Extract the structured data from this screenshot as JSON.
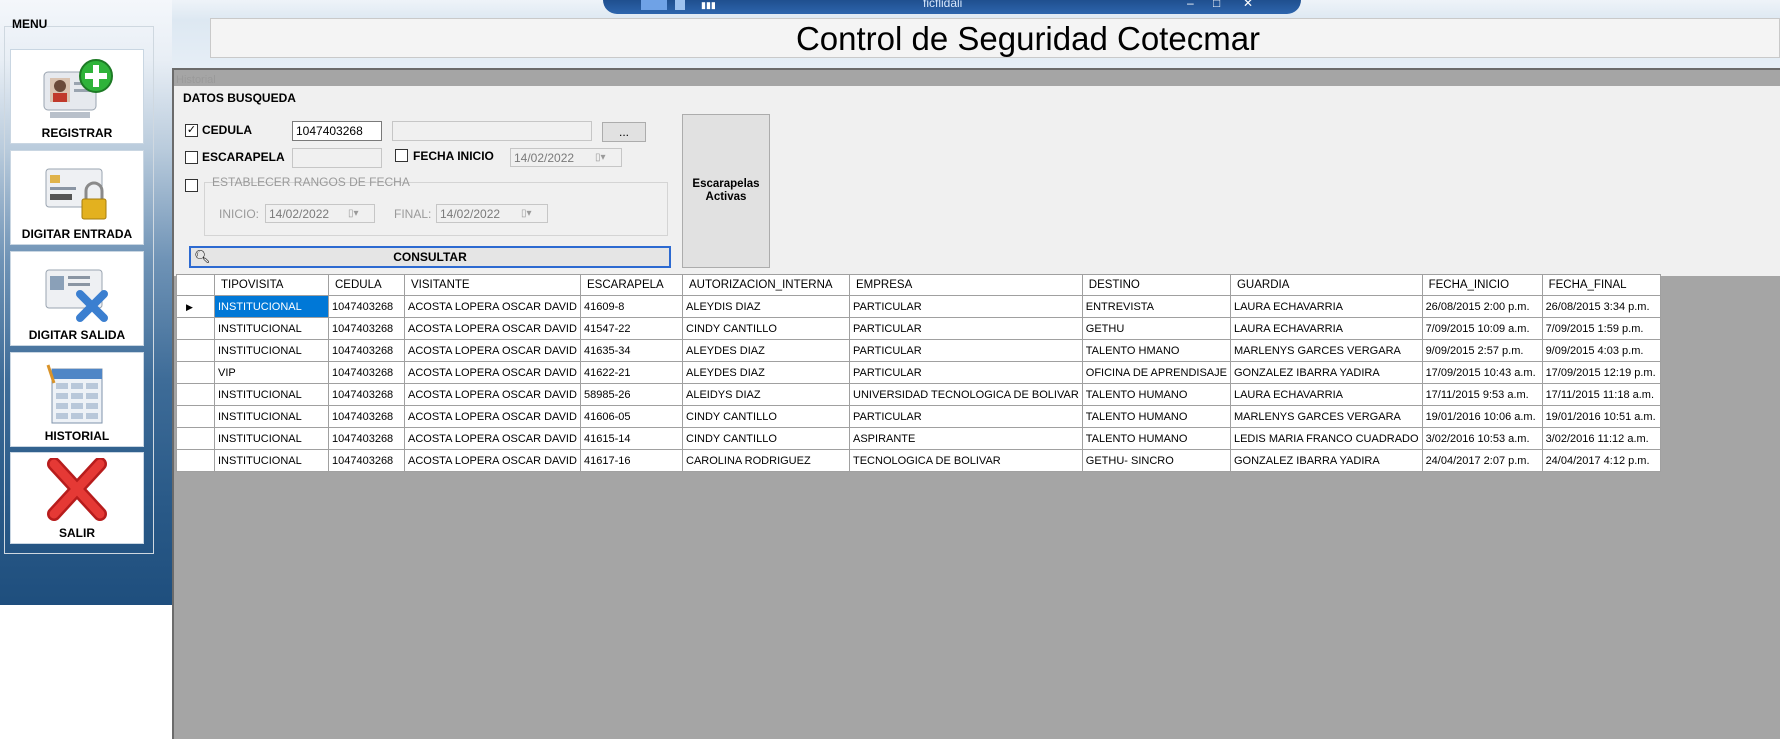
{
  "window": {
    "tab_title": "ficflidali",
    "app_title": "Control de Seguridad  Cotecmar"
  },
  "menu": {
    "title": "MENU",
    "items": [
      {
        "label": "REGISTRAR",
        "icon": "register-user-icon"
      },
      {
        "label": "DIGITAR ENTRADA",
        "icon": "id-card-lock-icon"
      },
      {
        "label": "DIGITAR SALIDA",
        "icon": "id-card-x-icon"
      },
      {
        "label": "HISTORIAL",
        "icon": "history-table-icon"
      },
      {
        "label": "SALIR",
        "icon": "exit-x-icon"
      }
    ]
  },
  "historial": {
    "window_title": "Historial",
    "group_title": "DATOS BUSQUEDA",
    "cedula": {
      "label": "CEDULA",
      "checked": true,
      "value": "1047403268",
      "lookup_button": "..."
    },
    "escarapela": {
      "label": "ESCARAPELA",
      "checked": false,
      "value": ""
    },
    "fecha_inicio": {
      "label": "FECHA INICIO",
      "checked": false,
      "value": "14/02/2022"
    },
    "rangos": {
      "label": "ESTABLECER RANGOS DE FECHA",
      "checked": false,
      "inicio_label": "INICIO:",
      "inicio_value": "14/02/2022",
      "final_label": "FINAL:",
      "final_value": "14/02/2022"
    },
    "consultar_button": "CONSULTAR",
    "escarapelas_activas_button": "Escarapelas Activas"
  },
  "grid": {
    "columns": [
      "TIPOVISITA",
      "CEDULA",
      "VISITANTE",
      "ESCARAPELA",
      "AUTORIZACION_INTERNA",
      "EMPRESA",
      "DESTINO",
      "GUARDIA",
      "FECHA_INICIO",
      "FECHA_FINAL"
    ],
    "rows": [
      [
        "INSTITUCIONAL",
        "1047403268",
        "ACOSTA  LOPERA OSCAR DAVID",
        "41609-8",
        "ALEYDIS DIAZ",
        "PARTICULAR",
        "ENTREVISTA",
        "LAURA ECHAVARRIA",
        "26/08/2015 2:00 p.m.",
        "26/08/2015 3:34 p.m."
      ],
      [
        "INSTITUCIONAL",
        "1047403268",
        "ACOSTA  LOPERA OSCAR DAVID",
        "41547-22",
        "CINDY CANTILLO",
        "PARTICULAR",
        "GETHU",
        "LAURA ECHAVARRIA",
        "7/09/2015 10:09 a.m.",
        "7/09/2015 1:59 p.m."
      ],
      [
        "INSTITUCIONAL",
        "1047403268",
        "ACOSTA  LOPERA OSCAR DAVID",
        "41635-34",
        "ALEYDES DIAZ",
        "PARTICULAR",
        "TALENTO HMANO",
        "MARLENYS GARCES VERGARA",
        "9/09/2015 2:57 p.m.",
        "9/09/2015 4:03 p.m."
      ],
      [
        "VIP",
        "1047403268",
        "ACOSTA  LOPERA OSCAR DAVID",
        "41622-21",
        "ALEYDES DIAZ",
        "PARTICULAR",
        "OFICINA DE APRENDISAJE",
        "GONZALEZ IBARRA YADIRA",
        "17/09/2015 10:43 a.m.",
        "17/09/2015 12:19 p.m."
      ],
      [
        "INSTITUCIONAL",
        "1047403268",
        "ACOSTA  LOPERA OSCAR DAVID",
        "58985-26",
        "ALEIDYS DIAZ",
        "UNIVERSIDAD TECNOLOGICA DE BOLIVAR",
        "TALENTO HUMANO",
        "LAURA ECHAVARRIA",
        "17/11/2015 9:53 a.m.",
        "17/11/2015 11:18 a.m."
      ],
      [
        "INSTITUCIONAL",
        "1047403268",
        "ACOSTA  LOPERA OSCAR DAVID",
        "41606-05",
        "CINDY CANTILLO",
        "PARTICULAR",
        "TALENTO HUMANO",
        "MARLENYS GARCES VERGARA",
        "19/01/2016 10:06 a.m.",
        "19/01/2016 10:51 a.m."
      ],
      [
        "INSTITUCIONAL",
        "1047403268",
        "ACOSTA  LOPERA OSCAR DAVID",
        "41615-14",
        "CINDY CANTILLO",
        "ASPIRANTE",
        "TALENTO HUMANO",
        "LEDIS MARIA FRANCO CUADRADO",
        "3/02/2016 10:53 a.m.",
        "3/02/2016 11:12 a.m."
      ],
      [
        "INSTITUCIONAL",
        "1047403268",
        "ACOSTA  LOPERA OSCAR DAVID",
        "41617-16",
        "CAROLINA RODRIGUEZ",
        "TECNOLOGICA DE BOLIVAR",
        "GETHU- SINCRO",
        "GONZALEZ IBARRA YADIRA",
        "24/04/2017 2:07 p.m.",
        "24/04/2017 4:12 p.m."
      ]
    ]
  }
}
